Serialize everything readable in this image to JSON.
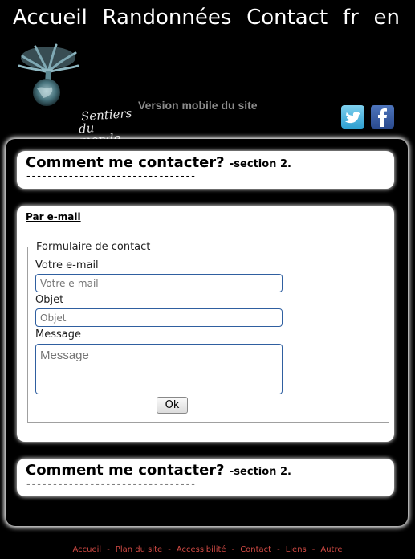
{
  "nav": {
    "items": [
      "Accueil",
      "Randonnées",
      "Contact"
    ],
    "langs": [
      "fr",
      "en"
    ]
  },
  "logo": {
    "line1": "Sentiers",
    "line2": "du monde"
  },
  "header": {
    "tagline": "Version mobile du site"
  },
  "social": {
    "twitter_icon": "twitter-icon",
    "facebook_icon": "facebook-icon"
  },
  "section_top": {
    "title": "Comment me contacter?",
    "subtitle": "-section 2.",
    "dashes": "--------------------------------"
  },
  "contact": {
    "by_email": "Par e-mail",
    "legend": "Formulaire de contact",
    "email_label": "Votre e-mail",
    "email_placeholder": "Votre e-mail",
    "subject_label": "Objet",
    "subject_placeholder": "Objet",
    "message_label": "Message",
    "message_placeholder": "Message",
    "submit": "Ok"
  },
  "section_bottom": {
    "title": "Comment me contacter?",
    "subtitle": "-section 2.",
    "dashes": "--------------------------------"
  },
  "footer": {
    "links": [
      "Accueil",
      "Plan du site",
      "Accessibilité",
      "Contact",
      "Liens",
      "Autre"
    ],
    "separator": "-"
  },
  "colors": {
    "footer_link": "#d04a44",
    "input_border": "#2f5fa0"
  }
}
